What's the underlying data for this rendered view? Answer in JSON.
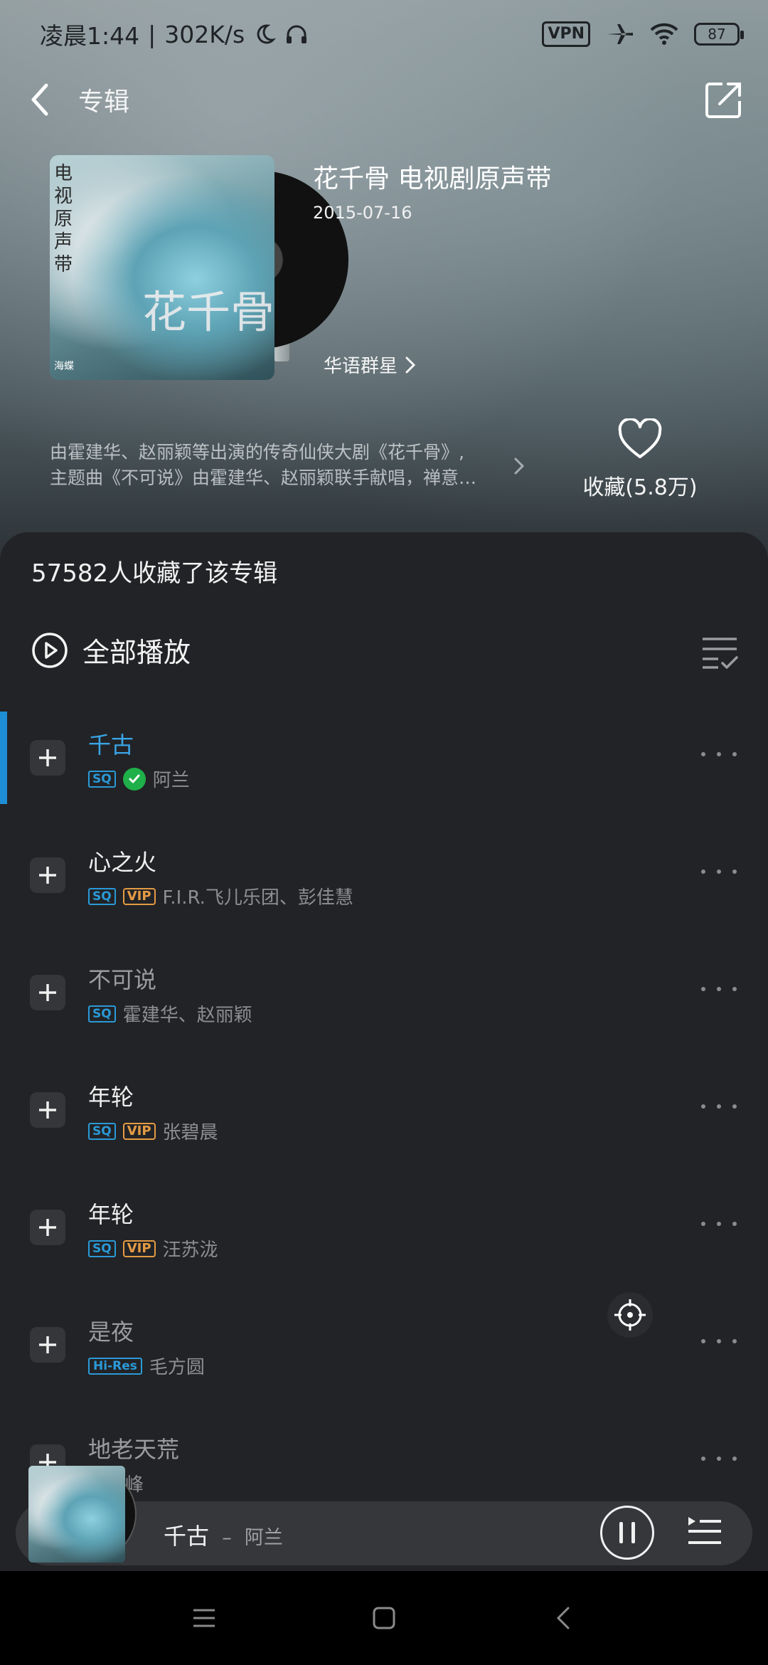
{
  "status_bar": {
    "time": "凌晨1:44",
    "separator": "|",
    "speed": "302K/s",
    "vpn": "VPN",
    "battery": "87"
  },
  "topbar": {
    "title": "专辑"
  },
  "album": {
    "name": "花千骨 电视剧原声带",
    "date": "2015-07-16",
    "artist": "华语群星",
    "cover_title": "电视原声带",
    "cover_script": "花千骨",
    "cover_logo": "海蝶",
    "description_line1": "由霍建华、赵丽颖等出演的传奇仙侠大剧《花千骨》,",
    "description_line2": "主题曲《不可说》由霍建华、赵丽颖联手献唱，禅意…",
    "favorite_label": "收藏(5.8万)"
  },
  "panel": {
    "collect_count": "57582人收藏了该专辑",
    "play_all": "全部播放"
  },
  "songs": [
    {
      "title": "千古",
      "artist": "阿兰",
      "badges": [
        "SQ"
      ],
      "downloaded": true,
      "active": true,
      "dim": false
    },
    {
      "title": "心之火",
      "artist": "F.I.R.飞儿乐团、彭佳慧",
      "badges": [
        "SQ",
        "VIP"
      ],
      "downloaded": false,
      "active": false,
      "dim": false
    },
    {
      "title": "不可说",
      "artist": "霍建华、赵丽颖",
      "badges": [
        "SQ"
      ],
      "downloaded": false,
      "active": false,
      "dim": true
    },
    {
      "title": "年轮",
      "artist": "张碧晨",
      "badges": [
        "SQ",
        "VIP"
      ],
      "downloaded": false,
      "active": false,
      "dim": false
    },
    {
      "title": "年轮",
      "artist": "汪苏泷",
      "badges": [
        "SQ",
        "VIP"
      ],
      "downloaded": false,
      "active": false,
      "dim": false
    },
    {
      "title": "是夜",
      "artist": "毛方圆",
      "badges": [
        "Hi-Res"
      ],
      "downloaded": false,
      "active": false,
      "dim": true
    },
    {
      "title": "地老天荒",
      "artist": "张贝峰",
      "badges": [],
      "downloaded": false,
      "active": false,
      "dim": true
    }
  ],
  "player": {
    "title": "千古",
    "separator": "–",
    "artist": "阿兰"
  },
  "colors": {
    "accent": "#1e8fd6",
    "sq_badge": "#2a9ad8",
    "vip_badge": "#e49b44",
    "download_ok": "#1fb04a"
  }
}
